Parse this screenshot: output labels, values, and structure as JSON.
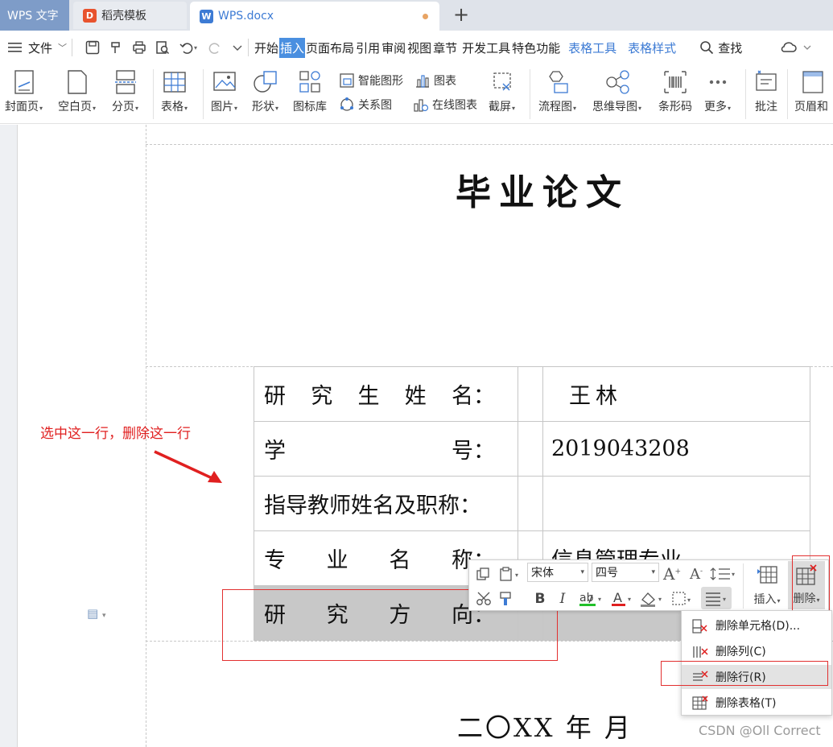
{
  "tabs": {
    "app": "WPS 文字",
    "template": "稻壳模板",
    "document": "WPS.docx"
  },
  "menu": {
    "file": "文件",
    "items": [
      "开始",
      "插入",
      "页面布局",
      "引用",
      "审阅",
      "视图",
      "章节",
      "开发工具",
      "特色功能"
    ],
    "active": "插入",
    "table_tools": "表格工具",
    "table_style": "表格样式",
    "search": "查找"
  },
  "ribbon": {
    "cover": "封面页",
    "blank": "空白页",
    "pagebreak": "分页",
    "table": "表格",
    "picture": "图片",
    "shape": "形状",
    "iconlib": "图标库",
    "smartart": "智能图形",
    "chart": "图表",
    "relation": "关系图",
    "online_chart": "在线图表",
    "screenshot": "截屏",
    "flowchart": "流程图",
    "mindmap": "思维导图",
    "barcode": "条形码",
    "more": "更多",
    "comment": "批注",
    "header_footer": "页眉和"
  },
  "document": {
    "title": "毕业论文",
    "rows": [
      {
        "label": [
          "研",
          "究",
          "生",
          "姓",
          "名："
        ],
        "value": "王林"
      },
      {
        "label": [
          "学",
          "号："
        ],
        "value": "2019043208"
      },
      {
        "label": [
          "指导教师姓名及职称："
        ],
        "value": ""
      },
      {
        "label": [
          "专",
          "业",
          "名",
          "称："
        ],
        "value": "信息管理专业"
      },
      {
        "label": [
          "研",
          "究",
          "方",
          "向："
        ],
        "value": ""
      }
    ],
    "date": "二〇XX 年   月"
  },
  "annotation": "选中这一行，删除这一行",
  "float_toolbar": {
    "font": "宋体",
    "size": "四号",
    "insert": "插入",
    "delete": "删除"
  },
  "context_menu": {
    "items": [
      "删除单元格(D)...",
      "删除列(C)",
      "删除行(R)",
      "删除表格(T)"
    ],
    "highlighted": "删除行(R)"
  },
  "watermark": "CSDN @Oll Correct",
  "colors": {
    "accent": "#4a8fe0",
    "annotation_red": "#e02020",
    "selection_gray": "#c8c8c8"
  }
}
